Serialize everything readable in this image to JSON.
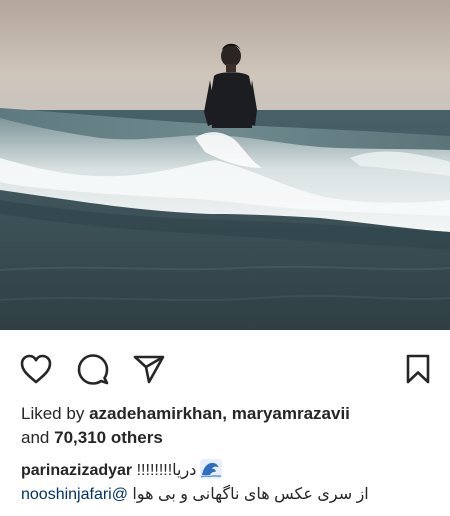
{
  "post": {
    "photo": {
      "subject": "person standing in sea waves"
    },
    "actions": {
      "like_icon": "heart-outline-icon",
      "comment_icon": "speech-bubble-icon",
      "share_icon": "paper-plane-icon",
      "save_icon": "bookmark-icon"
    },
    "likes": {
      "prefix": "Liked by",
      "user1": "azadehamirkhan",
      "separator": ",",
      "user2": "maryamrazavii",
      "and": "and",
      "count": "70,310 others"
    },
    "caption": {
      "username": "parinazizadyar",
      "text1": "دریا!!!!!!!!",
      "wave_icon": "water-wave-icon",
      "mention": "nooshinjafari@",
      "text2": "از سری عکس های ناگهانی و بی هوا"
    }
  }
}
